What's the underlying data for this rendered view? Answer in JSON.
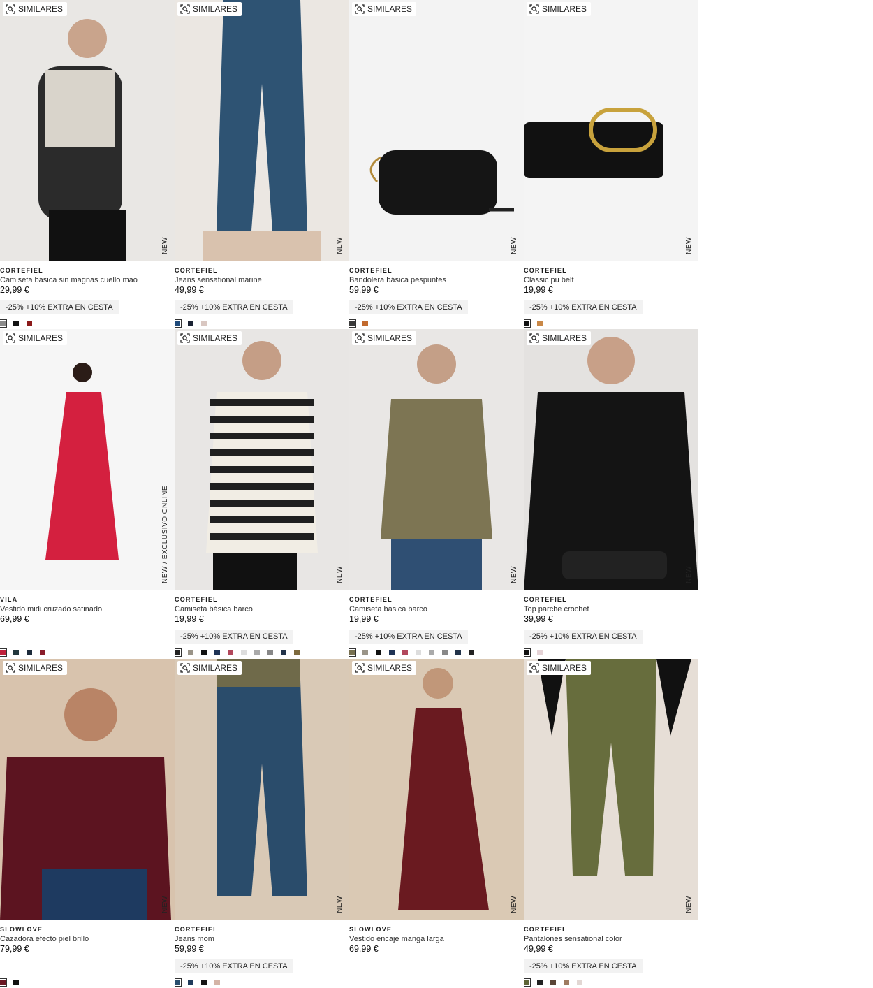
{
  "ui": {
    "similares_label": "SIMILARES",
    "promo_label": "-25% +10% EXTRA EN CESTA"
  },
  "products": [
    {
      "brand": "CORTEFIEL",
      "name": "Camiseta básica sin magnas cuello mao",
      "price": "29,99 €",
      "tag": "NEW",
      "promo": true,
      "bg": "#e9e7e4",
      "swatches": [
        "#8a8a8a",
        "#111111",
        "#8b1a1a"
      ]
    },
    {
      "brand": "CORTEFIEL",
      "name": "Jeans sensational marine",
      "price": "49,99 €",
      "tag": "NEW",
      "promo": true,
      "bg": "#ebe7e2",
      "swatches": [
        "#1f4a7a",
        "#1a2233",
        "#d9c7c1"
      ]
    },
    {
      "brand": "CORTEFIEL",
      "name": "Bandolera básica pespuntes",
      "price": "59,99 €",
      "tag": "NEW",
      "promo": true,
      "bg": "#f3f3f3",
      "swatches": [
        "#3a3a3a",
        "#c26a2e"
      ]
    },
    {
      "brand": "CORTEFIEL",
      "name": "Classic pu belt",
      "price": "19,99 €",
      "tag": "NEW",
      "promo": true,
      "bg": "#f4f4f4",
      "swatches": [
        "#111111",
        "#c98847"
      ]
    },
    {
      "brand": "VILA",
      "name": "Vestido midi cruzado satinado",
      "price": "69,99 €",
      "tag": "NEW / EXCLUSIVO ONLINE",
      "promo": false,
      "bg": "#f6f6f6",
      "swatches": [
        "#c0213b",
        "#22373d",
        "#1c2a3a",
        "#8a1c2a"
      ]
    },
    {
      "brand": "CORTEFIEL",
      "name": "Camiseta básica barco",
      "price": "19,99 €",
      "tag": "NEW",
      "promo": true,
      "bg": "#e8e6e4",
      "swatches": [
        "#222222",
        "#9a9488",
        "#111111",
        "#1f3355",
        "#b2485c",
        "#dddddd",
        "#aaaaaa",
        "#888888",
        "#22334a",
        "#7d6a3e"
      ]
    },
    {
      "brand": "CORTEFIEL",
      "name": "Camiseta básica barco",
      "price": "19,99 €",
      "tag": "NEW",
      "promo": true,
      "bg": "#e9e7e5",
      "swatches": [
        "#777050",
        "#9a9488",
        "#111111",
        "#1f3355",
        "#b2485c",
        "#dddddd",
        "#aaaaaa",
        "#888888",
        "#22334a",
        "#222222"
      ]
    },
    {
      "brand": "CORTEFIEL",
      "name": "Top parche crochet",
      "price": "39,99 €",
      "tag": "NEW",
      "promo": true,
      "bg": "#e4e2e0",
      "swatches": [
        "#111111",
        "#e5d3d6"
      ]
    },
    {
      "brand": "SLOWLOVE",
      "name": "Cazadora efecto piel brillo",
      "price": "79,99 €",
      "tag": "NEW",
      "promo": false,
      "bg": "#d8c3ad",
      "swatches": [
        "#6a1622",
        "#111111"
      ]
    },
    {
      "brand": "CORTEFIEL",
      "name": "Jeans mom",
      "price": "59,99 €",
      "tag": "NEW",
      "promo": true,
      "bg": "#d9c9b6",
      "swatches": [
        "#2a4f6e",
        "#1f3a5a",
        "#151515",
        "#d4b4a6"
      ]
    },
    {
      "brand": "SLOWLOVE",
      "name": "Vestido encaje manga larga",
      "price": "69,99 €",
      "tag": "NEW",
      "promo": false,
      "bg": "#dac9b4",
      "swatches": []
    },
    {
      "brand": "CORTEFIEL",
      "name": "Pantalones sensational color",
      "price": "49,99 €",
      "tag": "NEW",
      "promo": true,
      "bg": "#e6ded6",
      "swatches": [
        "#5e6536",
        "#222222",
        "#5a4536",
        "#9e7b60",
        "#e2d7d3"
      ]
    }
  ]
}
